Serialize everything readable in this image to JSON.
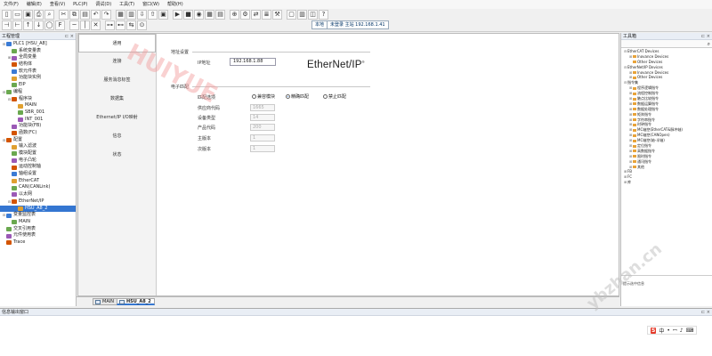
{
  "menu": [
    "文件(F)",
    "编辑(E)",
    "查看(V)",
    "PLC(P)",
    "调试(D)",
    "工具(T)",
    "窗口(W)",
    "帮助(H)"
  ],
  "toolbar": {
    "mode_label": "本地",
    "connection_label": "未登录 主站 192.168.1.41"
  },
  "project_panel": {
    "title": "工程管理",
    "tree": [
      {
        "label": "PLC1 [HSU_A8]",
        "level": 0,
        "exp": "⊟"
      },
      {
        "label": "系统变量表",
        "level": 1,
        "exp": ""
      },
      {
        "label": "全局变量",
        "level": 1,
        "exp": "⊞"
      },
      {
        "label": "结构体",
        "level": 1,
        "exp": ""
      },
      {
        "label": "软元件表",
        "level": 1,
        "exp": ""
      },
      {
        "label": "功能块实例",
        "level": 1,
        "exp": ""
      },
      {
        "label": "EIP",
        "level": 1,
        "exp": ""
      },
      {
        "label": "编程",
        "level": 0,
        "exp": "⊟"
      },
      {
        "label": "程序块",
        "level": 1,
        "exp": "⊟"
      },
      {
        "label": "MAIN",
        "level": 2,
        "exp": ""
      },
      {
        "label": "SBR_001",
        "level": 2,
        "exp": ""
      },
      {
        "label": "INT_001",
        "level": 2,
        "exp": ""
      },
      {
        "label": "功能块(FB)",
        "level": 1,
        "exp": ""
      },
      {
        "label": "函数(FC)",
        "level": 1,
        "exp": ""
      },
      {
        "label": "配置",
        "level": 0,
        "exp": "⊟"
      },
      {
        "label": "输入滤波",
        "level": 1,
        "exp": ""
      },
      {
        "label": "模块配置",
        "level": 1,
        "exp": ""
      },
      {
        "label": "电子凸轮",
        "level": 1,
        "exp": ""
      },
      {
        "label": "运动控制轴",
        "level": 1,
        "exp": ""
      },
      {
        "label": "轴组设置",
        "level": 1,
        "exp": ""
      },
      {
        "label": "EtherCAT",
        "level": 1,
        "exp": ""
      },
      {
        "label": "CAN(CANLink)",
        "level": 1,
        "exp": ""
      },
      {
        "label": "以太网",
        "level": 1,
        "exp": ""
      },
      {
        "label": "EtherNet/IP",
        "level": 1,
        "exp": "⊟"
      },
      {
        "label": "HSU_A8_2",
        "level": 2,
        "exp": "",
        "selected": true
      },
      {
        "label": "变量监控表",
        "level": 0,
        "exp": "⊟"
      },
      {
        "label": "MAIN",
        "level": 1,
        "exp": ""
      },
      {
        "label": "交叉引用表",
        "level": 0,
        "exp": ""
      },
      {
        "label": "元件使用表",
        "level": 0,
        "exp": ""
      },
      {
        "label": "Trace",
        "level": 0,
        "exp": ""
      }
    ]
  },
  "config_nav": [
    "通用",
    "连接",
    "服务消息标签",
    "数据集",
    "Ethernet/IP I/O映射",
    "信息",
    "状态"
  ],
  "config_nav_active": 0,
  "address": {
    "section": "地址设置",
    "ip_label": "IP地址",
    "ip_value": "192.168.1.88"
  },
  "logo_text": "EtherNet/IP",
  "keying": {
    "section": "电子匹配",
    "match_label": "匹配选项",
    "options": [
      "兼容模块",
      "精确匹配",
      "禁止匹配"
    ],
    "selected": 1,
    "fields": [
      {
        "label": "供应商代码",
        "value": "1665"
      },
      {
        "label": "设备类型",
        "value": "14"
      },
      {
        "label": "产品代码",
        "value": "200"
      },
      {
        "label": "主版本",
        "value": "1"
      },
      {
        "label": "次版本",
        "value": "1"
      }
    ]
  },
  "doc_tabs": [
    {
      "label": "MAIN",
      "active": false
    },
    {
      "label": "HSU_A8_2",
      "active": true
    }
  ],
  "toolbox": {
    "title": "工具箱",
    "items": [
      {
        "label": "EtherCAT Devices",
        "level": 0,
        "exp": "⊟"
      },
      {
        "label": "Inovance Devices",
        "level": 1,
        "exp": "⊞"
      },
      {
        "label": "Other Devices",
        "level": 1,
        "exp": ""
      },
      {
        "label": "EtherNet/IP Devices",
        "level": 0,
        "exp": "⊟"
      },
      {
        "label": "Inovance Devices",
        "level": 1,
        "exp": "⊞"
      },
      {
        "label": "Other Devices",
        "level": 1,
        "exp": "⊞"
      },
      {
        "label": "指令集",
        "level": 0,
        "exp": "⊟"
      },
      {
        "label": "程序逻辑指令",
        "level": 1,
        "exp": "⊞"
      },
      {
        "label": "流程控制指令",
        "level": 1,
        "exp": "⊞"
      },
      {
        "label": "触点比较指令",
        "level": 1,
        "exp": "⊞"
      },
      {
        "label": "数据运算指令",
        "level": 1,
        "exp": "⊞"
      },
      {
        "label": "数据处理指令",
        "level": 1,
        "exp": "⊞"
      },
      {
        "label": "矩阵指令",
        "level": 1,
        "exp": "⊞"
      },
      {
        "label": "字符串指令",
        "level": 1,
        "exp": "⊞"
      },
      {
        "label": "时钟指令",
        "level": 1,
        "exp": "⊞"
      },
      {
        "label": "MC轴控(EtherCAT&脉冲轴)",
        "level": 1,
        "exp": "⊞"
      },
      {
        "label": "MC轴控(CANOpen)",
        "level": 1,
        "exp": "⊞"
      },
      {
        "label": "MC轴控(轴-半轴)",
        "level": 1,
        "exp": "⊞"
      },
      {
        "label": "定位指令",
        "level": 1,
        "exp": "⊞"
      },
      {
        "label": "高数据指令",
        "level": 1,
        "exp": "⊞"
      },
      {
        "label": "限时指令",
        "level": 1,
        "exp": "⊞"
      },
      {
        "label": "通讯指令",
        "level": 1,
        "exp": "⊞"
      },
      {
        "label": "其他",
        "level": 1,
        "exp": "⊞"
      },
      {
        "label": "FB",
        "level": 0,
        "exp": "⊞"
      },
      {
        "label": "FC",
        "level": 0,
        "exp": "⊞"
      },
      {
        "label": "库",
        "level": 0,
        "exp": "⊞"
      }
    ],
    "hint": "提示选中信息"
  },
  "output": {
    "title": "信息输出窗口"
  },
  "watermarks": [
    "HUIYUE",
    "ybzhan.cn"
  ],
  "ime": [
    "S",
    "中",
    "•",
    "ꟷ",
    "♪",
    "⌨"
  ]
}
